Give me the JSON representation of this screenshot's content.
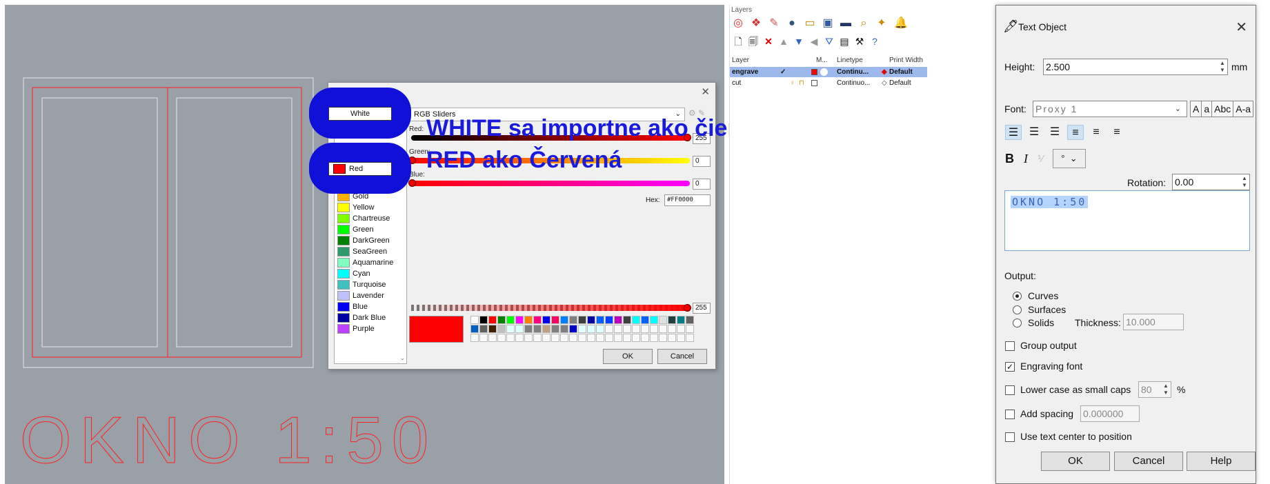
{
  "viewport": {
    "text_label": "OKNO 1:50"
  },
  "color_dialog": {
    "colors": [
      {
        "name": "White",
        "hex": "#ffffff"
      },
      {
        "name": "Red",
        "hex": "#ff0000"
      },
      {
        "name": "Gold",
        "hex": "#ffb000"
      },
      {
        "name": "Yellow",
        "hex": "#ffff00"
      },
      {
        "name": "Chartreuse",
        "hex": "#80ff00"
      },
      {
        "name": "Green",
        "hex": "#00ff00"
      },
      {
        "name": "DarkGreen",
        "hex": "#008000"
      },
      {
        "name": "SeaGreen",
        "hex": "#2e9a6a"
      },
      {
        "name": "Aquamarine",
        "hex": "#80ffc0"
      },
      {
        "name": "Cyan",
        "hex": "#00ffff"
      },
      {
        "name": "Turquoise",
        "hex": "#40c0c0"
      },
      {
        "name": "Lavender",
        "hex": "#c0c0ff"
      },
      {
        "name": "Blue",
        "hex": "#0000ff"
      },
      {
        "name": "Dark Blue",
        "hex": "#0000a0"
      },
      {
        "name": "Purple",
        "hex": "#c040ff"
      }
    ],
    "mode": "RGB Sliders",
    "red_label": "Red:",
    "green_label": "Green:",
    "blue_label": "Blue:",
    "red_value": "255",
    "green_value": "0",
    "blue_value": "0",
    "hex_label": "Hex:",
    "hex_value": "#FF0000",
    "alpha_value": "255",
    "ok_label": "OK",
    "cancel_label": "Cancel"
  },
  "annotations": {
    "white_note": "WHITE sa importne ako čierna",
    "red_note": "RED ako Červená"
  },
  "layers": {
    "title": "Layers",
    "header": {
      "layer": "Layer",
      "m": "M...",
      "linetype": "Linetype",
      "print_width": "Print Width"
    },
    "rows": [
      {
        "name": "engrave",
        "linetype": "Continu...",
        "print_width": "Default",
        "color": "#ff0000"
      },
      {
        "name": "cut",
        "linetype": "Continuo...",
        "print_width": "Default",
        "color": "#ffffff"
      }
    ]
  },
  "text_object": {
    "title": "Text Object",
    "height_label": "Height:",
    "height_value": "2.500",
    "height_unit": "mm",
    "font_label": "Font:",
    "font_value": "Proxy 1",
    "font_buttons": [
      "A",
      "a",
      "Abc",
      "A-a"
    ],
    "rotation_label": "Rotation:",
    "rotation_value": "0.00",
    "text_value": "OKNO 1:50",
    "output_label": "Output:",
    "output_options": [
      "Curves",
      "Surfaces",
      "Solids"
    ],
    "output_selected": "Curves",
    "thickness_label": "Thickness:",
    "thickness_value": "10.000",
    "group_output_label": "Group output",
    "group_output_checked": false,
    "engraving_font_label": "Engraving font",
    "engraving_font_checked": true,
    "lower_case_label": "Lower case as small caps",
    "lower_case_checked": false,
    "lower_case_value": "80",
    "lower_case_unit": "%",
    "add_spacing_label": "Add spacing",
    "add_spacing_checked": false,
    "add_spacing_value": "0.000000",
    "text_center_label": "Use text center to position",
    "text_center_checked": false,
    "ok_label": "OK",
    "cancel_label": "Cancel",
    "help_label": "Help"
  }
}
